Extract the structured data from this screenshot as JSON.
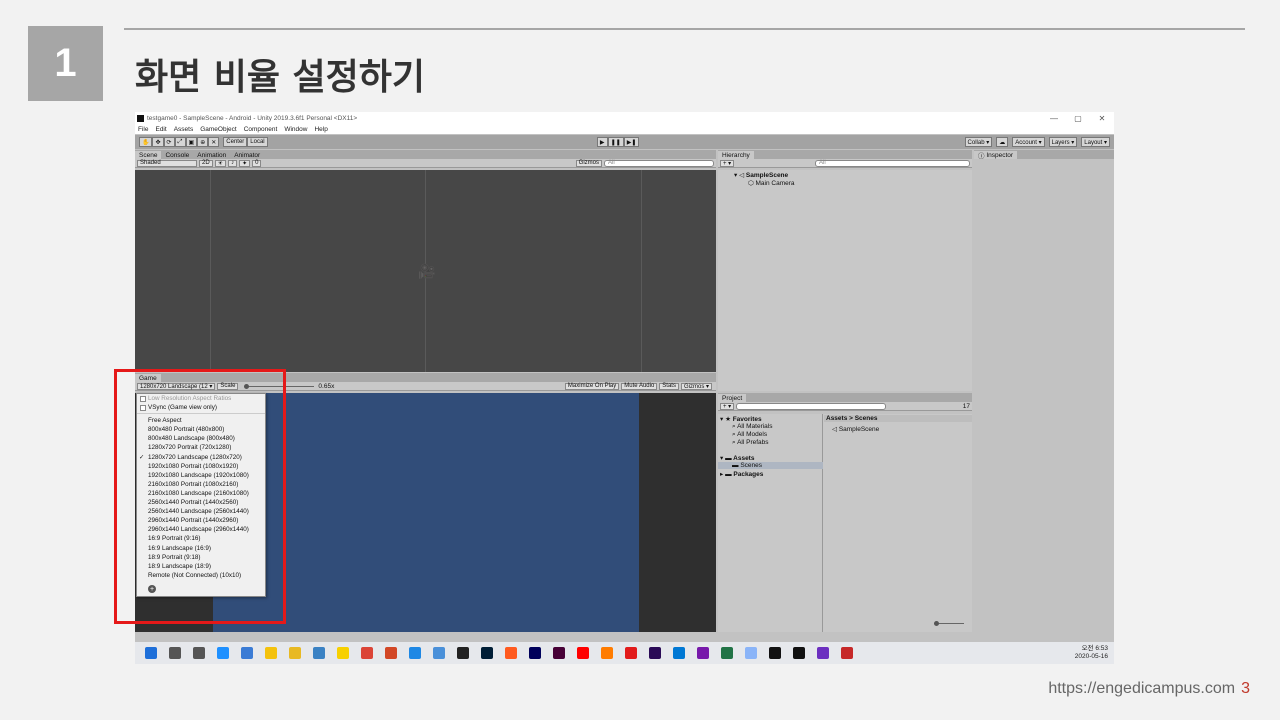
{
  "slide": {
    "number": "1",
    "title": "화면 비율 설정하기",
    "footer_url": "https://engedicampus.com",
    "page": "3"
  },
  "window": {
    "title": "testgame0 - SampleScene - Android - Unity 2019.3.6f1 Personal <DX11>",
    "minimize": "—",
    "restore": "▢",
    "close": "✕"
  },
  "menu": [
    "File",
    "Edit",
    "Assets",
    "GameObject",
    "Component",
    "Window",
    "Help"
  ],
  "toolbar": {
    "tools": [
      "✋",
      "✥",
      "⟳",
      "⤢",
      "▣",
      "⊕",
      "✕"
    ],
    "center": "Center",
    "local": "Local",
    "play": "▶",
    "pause": "❚❚",
    "step": "▶❚",
    "collab": "Collab ▾",
    "cloud": "☁",
    "account": "Account ▾",
    "layers": "Layers ▾",
    "layout": "Layout ▾"
  },
  "scene_tabs": [
    "Scene",
    "Console",
    "Animation",
    "Animator"
  ],
  "scene_ctrl": {
    "shaded": "Shaded",
    "mode2d": "2D",
    "gizmos": "Gizmos",
    "search": "All",
    "counter": "0"
  },
  "game": {
    "tab": "Game",
    "resolution": "1280x720 Landscape (12 ▾",
    "scale_label": "Scale",
    "scale_value": "0.65x",
    "maximize": "Maximize On Play",
    "mute": "Mute Audio",
    "stats": "Stats",
    "gizmos": "Gizmos ▾"
  },
  "dropdown": {
    "low_res": "Low Resolution Aspect Ratios",
    "vsync": "VSync (Game view only)",
    "selected_mark": "✓",
    "items": [
      "Free Aspect",
      "800x480 Portrait (480x800)",
      "800x480 Landscape (800x480)",
      "1280x720 Portrait (720x1280)",
      "1280x720 Landscape (1280x720)",
      "1920x1080 Portrait (1080x1920)",
      "1920x1080 Landscape (1920x1080)",
      "2160x1080 Portrait (1080x2160)",
      "2160x1080 Landscape (2160x1080)",
      "2560x1440 Portrait (1440x2560)",
      "2560x1440 Landscape (2560x1440)",
      "2960x1440 Portrait (1440x2960)",
      "2960x1440 Landscape (2960x1440)",
      "16:9 Portrait (9:16)",
      "16:9 Landscape (16:9)",
      "18:9 Portrait (9:18)",
      "18:9 Landscape (18:9)",
      "Remote (Not Connected) (10x10)"
    ],
    "add": "+"
  },
  "hierarchy": {
    "tab": "Hierarchy",
    "search": "All",
    "scene": "SampleScene",
    "camera": "Main Camera"
  },
  "project": {
    "tab": "Project",
    "favorites": "Favorites",
    "fav_items": [
      "All Materials",
      "All Models",
      "All Prefabs"
    ],
    "assets": "Assets",
    "scenes": "Scenes",
    "packages": "Packages",
    "breadcrumb": "Assets > Scenes",
    "file": "SampleScene",
    "count": "17"
  },
  "inspector": {
    "tab": "Inspector"
  },
  "taskbar": {
    "clock_line1": "오전 6:53",
    "clock_line2": "2020-05-16",
    "icon_colors": [
      "#1e6fd9",
      "#555",
      "#555",
      "#1e90ff",
      "#3a7bd5",
      "#f4c20d",
      "#e8b923",
      "#3b82c4",
      "#f7d000",
      "#db4437",
      "#d24726",
      "#1e88e5",
      "#4a90d9",
      "#222",
      "#001e36",
      "#ff5a1f",
      "#00005b",
      "#470137",
      "#ff0000",
      "#ff7c00",
      "#e21b1b",
      "#2a0a56",
      "#0078d4",
      "#7719aa",
      "#217346",
      "#8ab4f8",
      "#111",
      "#111",
      "#6c2fc0",
      "#c62828"
    ]
  }
}
